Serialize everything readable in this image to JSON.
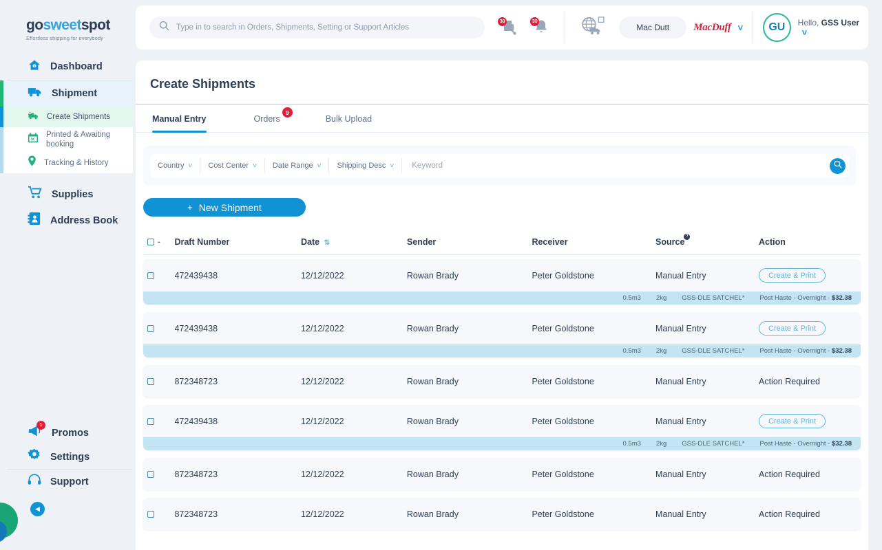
{
  "brand": {
    "go": "go",
    "sweet": "sweet",
    "spot": "spot",
    "tagline": "Effortless shipping for everybody"
  },
  "sidebar": {
    "items": [
      {
        "label": "Dashboard",
        "icon": "home-icon"
      },
      {
        "label": "Shipment",
        "icon": "truck-icon"
      },
      {
        "label": "Supplies",
        "icon": "cart-icon"
      },
      {
        "label": "Address Book",
        "icon": "address-book-icon"
      }
    ],
    "sub_items": [
      {
        "label": "Create Shipments",
        "icon": "truck-plus-icon"
      },
      {
        "label": "Printed & Awaiting booking",
        "icon": "calendar-icon"
      },
      {
        "label": "Tracking & History",
        "icon": "pin-icon"
      }
    ],
    "bottom_items": [
      {
        "label": "Promos",
        "icon": "megaphone-icon",
        "badge": "1"
      },
      {
        "label": "Settings",
        "icon": "gear-icon",
        "badge": ""
      },
      {
        "label": "Support",
        "icon": "headset-icon",
        "badge": ""
      }
    ],
    "collapse_icon": "chevron-left-icon"
  },
  "header": {
    "search_placeholder": "Type in to search in Orders, Shipments, Setting or Support Articles",
    "search_icon": "search-icon",
    "notifications": [
      {
        "icon": "printer-icon",
        "badge": "30"
      },
      {
        "icon": "bell-icon",
        "badge": "30"
      }
    ],
    "globe_icon": "globe-truck-icon",
    "account_name": "Mac Dutt",
    "brand_logo_text": "MacDuff",
    "avatar_initials": "GU",
    "greeting_prefix": "Hello, ",
    "user_name": "GSS User",
    "chevron_icon": "chevron-down-icon"
  },
  "page": {
    "title": "Create Shipments",
    "tabs": [
      {
        "label": "Manual Entry",
        "badge": ""
      },
      {
        "label": "Orders",
        "badge": "9"
      },
      {
        "label": "Bulk Upload",
        "badge": ""
      }
    ]
  },
  "filters": {
    "dropdowns": [
      {
        "label": "Country"
      },
      {
        "label": "Cost Center"
      },
      {
        "label": "Date Range"
      },
      {
        "label": "Shipping Desc"
      }
    ],
    "keyword_placeholder": "Keyword",
    "search_icon": "search-icon"
  },
  "actions": {
    "new_shipment": "New Shipment",
    "plus": "+"
  },
  "table": {
    "columns": [
      {
        "key": "check",
        "label": ""
      },
      {
        "key": "draft",
        "label": "Draft Number"
      },
      {
        "key": "date",
        "label": "Date"
      },
      {
        "key": "sender",
        "label": "Sender"
      },
      {
        "key": "receiver",
        "label": "Receiver"
      },
      {
        "key": "source",
        "label": "Source"
      },
      {
        "key": "action",
        "label": "Action"
      }
    ],
    "header_dash": "-",
    "sort_icon": "sort-icon",
    "source_info_badge": "?",
    "rows": [
      {
        "draft": "472439438",
        "date": "12/12/2022",
        "sender": "Rowan Brady",
        "receiver": "Peter Goldstone",
        "source": "Manual Entry",
        "action": "Create & Print",
        "action_type": "button",
        "detail": {
          "volume": "0.5m3",
          "weight": "2kg",
          "product": "GSS-DLE SATCHEL*",
          "carrier": "Post Haste - Overnight - ",
          "price": "$32.38"
        }
      },
      {
        "draft": "472439438",
        "date": "12/12/2022",
        "sender": "Rowan Brady",
        "receiver": "Peter Goldstone",
        "source": "Manual Entry",
        "action": "Create & Print",
        "action_type": "button",
        "detail": {
          "volume": "0.5m3",
          "weight": "2kg",
          "product": "GSS-DLE SATCHEL*",
          "carrier": "Post Haste - Overnight - ",
          "price": "$32.38"
        }
      },
      {
        "draft": "872348723",
        "date": "12/12/2022",
        "sender": "Rowan Brady",
        "receiver": "Peter Goldstone",
        "source": "Manual Entry",
        "action": "Action Required",
        "action_type": "text",
        "detail": null
      },
      {
        "draft": "472439438",
        "date": "12/12/2022",
        "sender": "Rowan Brady",
        "receiver": "Peter Goldstone",
        "source": "Manual Entry",
        "action": "Create & Print",
        "action_type": "button",
        "detail": {
          "volume": "0.5m3",
          "weight": "2kg",
          "product": "GSS-DLE SATCHEL*",
          "carrier": "Post Haste - Overnight - ",
          "price": "$32.38"
        }
      },
      {
        "draft": "872348723",
        "date": "12/12/2022",
        "sender": "Rowan Brady",
        "receiver": "Peter Goldstone",
        "source": "Manual Entry",
        "action": "Action Required",
        "action_type": "text",
        "detail": null
      },
      {
        "draft": "872348723",
        "date": "12/12/2022",
        "sender": "Rowan Brady",
        "receiver": "Peter Goldstone",
        "source": "Manual Entry",
        "action": "Action Required",
        "action_type": "text",
        "detail": null
      }
    ]
  },
  "colors": {
    "accent_blue": "#1092d4",
    "accent_green": "#20b677",
    "badge_red": "#e01f3d",
    "detail_bg": "#c3e4f2",
    "text_dark": "#2d3e55"
  }
}
